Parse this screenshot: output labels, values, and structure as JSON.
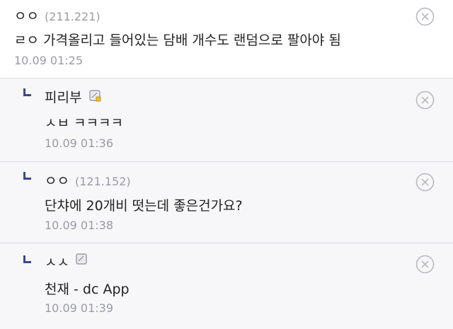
{
  "comments": [
    {
      "nick": "ㅇㅇ",
      "ip": "(211.221)",
      "text": "ㄹㅇ 가격올리고 들어있는 담배 개수도 랜덤으로 팔아야 됨",
      "date": "10.09 01:25"
    },
    {
      "nick": "피리부",
      "text": "ㅅㅂ ㅋㅋㅋㅋ",
      "date": "10.09 01:36",
      "icon": "gallog-icon"
    },
    {
      "nick": "ㅇㅇ",
      "ip": "(121.152)",
      "text": "단챠에 20개비 떳는데 좋은건가요?",
      "date": "10.09 01:38"
    },
    {
      "nick": "ㅅㅅ",
      "text": "천재 - dc App",
      "date": "10.09 01:39",
      "icon": "gallog-icon"
    }
  ],
  "colors": {
    "accent": "#3b4890",
    "meta": "#9a9aa5",
    "reply_bg": "#f7f7f9",
    "divider": "#dcdce3"
  }
}
